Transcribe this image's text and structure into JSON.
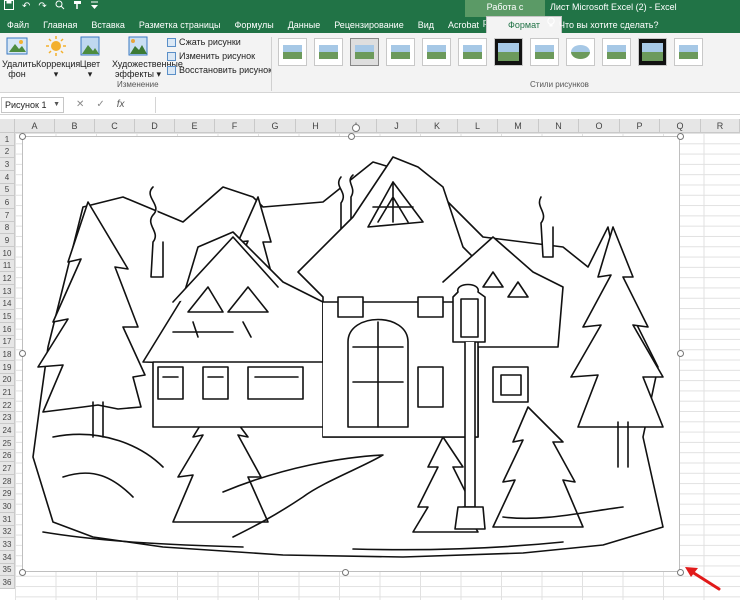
{
  "qat": {
    "undo_symbol": "↶",
    "redo_symbol": "↷"
  },
  "context_group": "Работа с рисунками",
  "window_title": "Лист Microsoft Excel (2) - Excel",
  "tabs": [
    {
      "label": "Файл"
    },
    {
      "label": "Главная"
    },
    {
      "label": "Вставка"
    },
    {
      "label": "Разметка страницы"
    },
    {
      "label": "Формулы"
    },
    {
      "label": "Данные"
    },
    {
      "label": "Рецензирование"
    },
    {
      "label": "Вид"
    },
    {
      "label": "Acrobat"
    },
    {
      "label": "Формат"
    }
  ],
  "tell_me": {
    "icon": "lightbulb-icon",
    "text": "Что вы хотите сделать?"
  },
  "ribbon": {
    "remove_bg": {
      "line1": "Удалить",
      "line2": "фон"
    },
    "correction": {
      "line1": "Коррекция",
      "line2": "▾"
    },
    "color": {
      "line1": "Цвет",
      "line2": "▾"
    },
    "artistic": {
      "line1": "Художественные",
      "line2": "эффекты ▾"
    },
    "compress": "Сжать рисунки",
    "change": "Изменить рисунок",
    "reset": "Восстановить рисунок",
    "group_adjust": "Изменение",
    "group_styles": "Стили рисунков"
  },
  "formula_bar": {
    "name_box": "Рисунок 1",
    "cancel": "✕",
    "enter": "✓",
    "fx": "fx"
  },
  "columns": [
    "A",
    "B",
    "C",
    "D",
    "E",
    "F",
    "G",
    "H",
    "I",
    "J",
    "K",
    "L",
    "M",
    "N",
    "O",
    "P",
    "Q",
    "R"
  ],
  "rows": [
    "1",
    "2",
    "3",
    "4",
    "5",
    "6",
    "7",
    "8",
    "9",
    "10",
    "11",
    "12",
    "13",
    "14",
    "15",
    "16",
    "17",
    "18",
    "19",
    "20",
    "21",
    "22",
    "23",
    "24",
    "25",
    "26",
    "27",
    "28",
    "29",
    "30",
    "31",
    "32",
    "33",
    "34",
    "35",
    "36"
  ],
  "picture": {
    "name": "winter-house-stencil"
  },
  "colors": {
    "excel_green": "#217346",
    "arrow_red": "#e11a1a"
  }
}
